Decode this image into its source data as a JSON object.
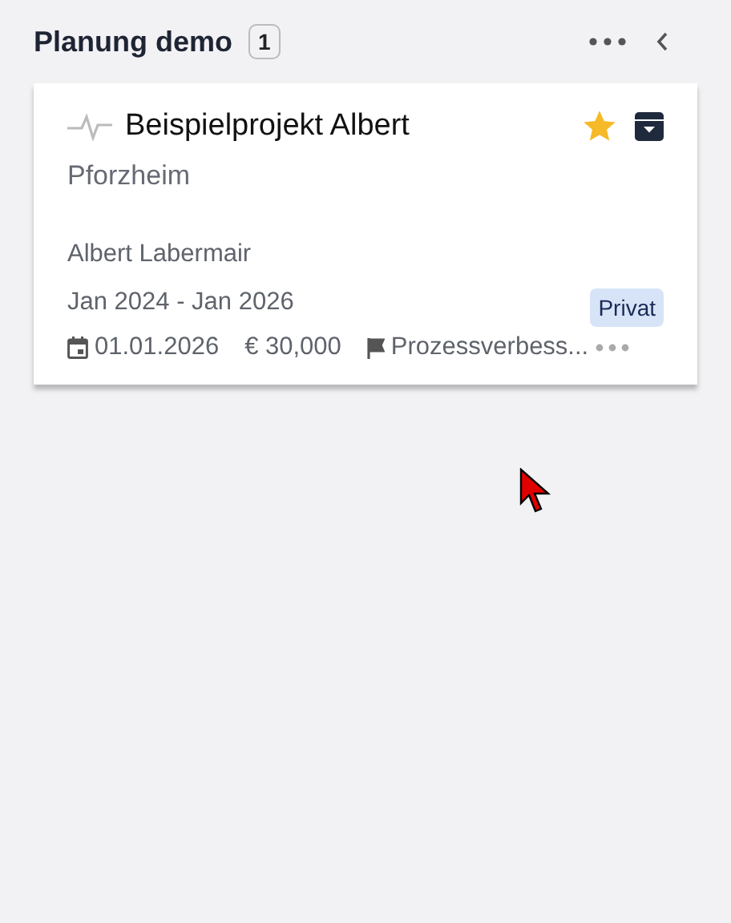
{
  "column": {
    "title": "Planung demo",
    "count": "1"
  },
  "card": {
    "title": "Beispielprojekt Albert",
    "starred": true,
    "location": "Pforzheim",
    "owner": "Albert Labermair",
    "period": "Jan 2024 - Jan 2026",
    "tag": "Privat",
    "due_date": "01.01.2026",
    "budget": "€ 30,000",
    "category": "Prozessverbess..."
  }
}
